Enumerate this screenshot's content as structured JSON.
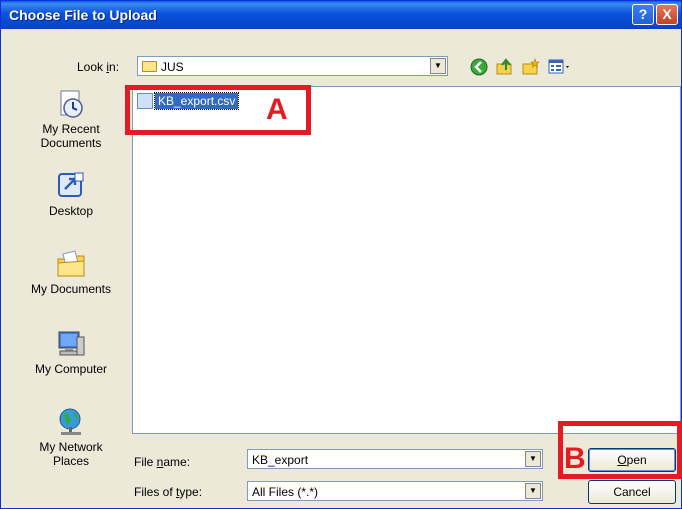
{
  "window": {
    "title": "Choose File to Upload"
  },
  "titlebar": {
    "help_label": "?",
    "close_label": "X"
  },
  "lookin": {
    "label_prefix": "Look ",
    "label_underline": "i",
    "label_suffix": "n:",
    "value": "JUS"
  },
  "places": [
    {
      "name": "recent",
      "label": "My Recent Documents",
      "icon": "recent-documents-icon"
    },
    {
      "name": "desktop",
      "label": "Desktop",
      "icon": "desktop-icon"
    },
    {
      "name": "documents",
      "label": "My Documents",
      "icon": "my-documents-icon"
    },
    {
      "name": "computer",
      "label": "My Computer",
      "icon": "my-computer-icon"
    },
    {
      "name": "network",
      "label": "My Network Places",
      "icon": "network-places-icon"
    }
  ],
  "files": [
    {
      "name": "KB_export.csv",
      "selected": true
    }
  ],
  "filename": {
    "label_prefix": "File ",
    "label_underline": "n",
    "label_suffix": "ame:",
    "value": "KB_export"
  },
  "filetype": {
    "label_prefix": "Files of ",
    "label_underline": "t",
    "label_suffix": "ype:",
    "value": "All Files (*.*)"
  },
  "buttons": {
    "open_underline": "O",
    "open_rest": "pen",
    "cancel": "Cancel"
  },
  "annotations": {
    "a": "A",
    "b": "B"
  },
  "colors": {
    "title_bar": "#0a52dd",
    "annotation": "#e51b24",
    "selection": "#316ac5"
  }
}
